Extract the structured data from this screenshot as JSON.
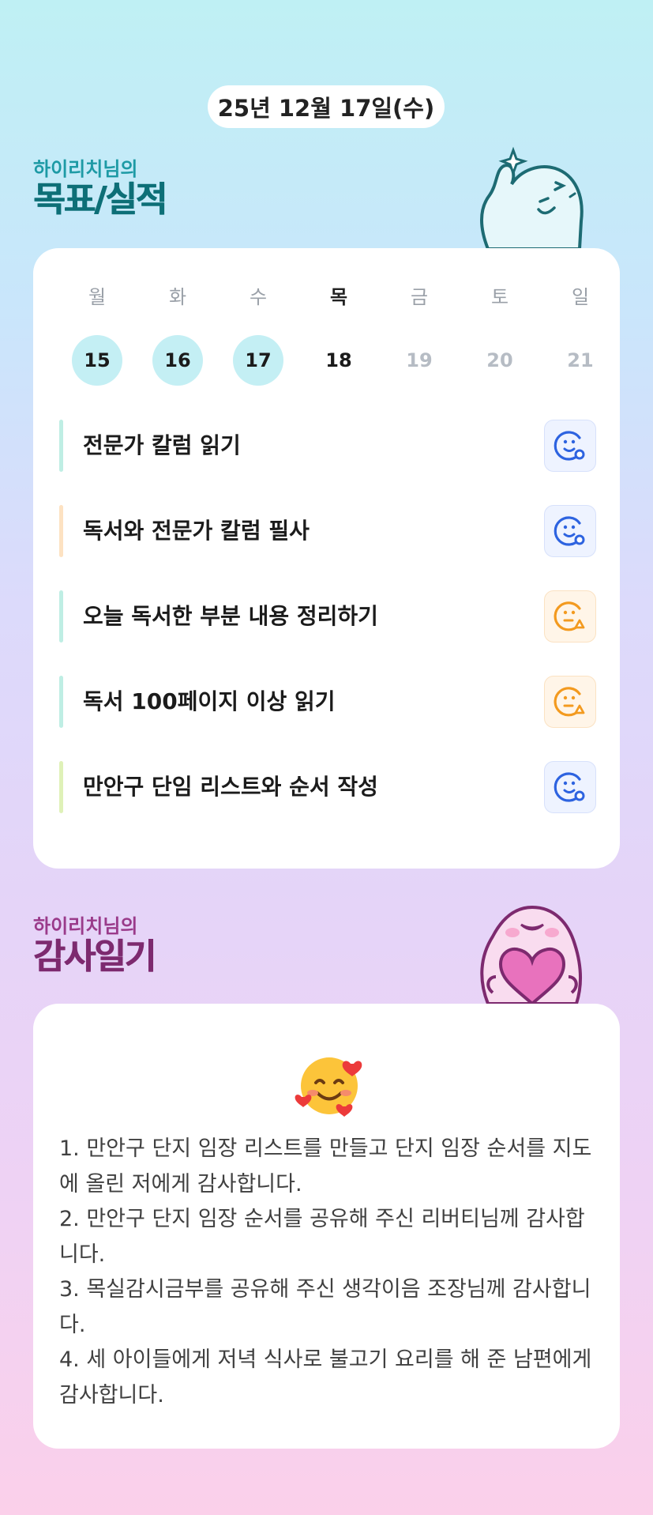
{
  "date_label": "25년 12월 17일(수)",
  "goals_section": {
    "subtitle": "하이리치님의",
    "title": "목표/실적"
  },
  "week": {
    "days": [
      "월",
      "화",
      "수",
      "목",
      "금",
      "토",
      "일"
    ],
    "dates": [
      "15",
      "16",
      "17",
      "18",
      "19",
      "20",
      "21"
    ]
  },
  "goals": [
    {
      "label": "전문가 칼럼 읽기",
      "bar_color": "#bfeee4",
      "status": "smile-check-icon",
      "color": "#2d63e0"
    },
    {
      "label": "독서와 전문가 칼럼 필사",
      "bar_color": "#fde2c2",
      "status": "smile-check-icon",
      "color": "#2d63e0"
    },
    {
      "label": "오늘 독서한 부분 내용 정리하기",
      "bar_color": "#bfeee4",
      "status": "neutral-triangle-icon",
      "color": "#f39a1f"
    },
    {
      "label": "독서 100페이지 이상 읽기",
      "bar_color": "#bfeee4",
      "status": "neutral-triangle-icon",
      "color": "#f39a1f"
    },
    {
      "label": "만안구 단임 리스트와 순서 작성",
      "bar_color": "#dff1b8",
      "status": "smile-check-icon",
      "color": "#2d63e0"
    }
  ],
  "diary_section": {
    "subtitle": "하이리치님의",
    "title": "감사일기"
  },
  "diary": {
    "emoji": "smiling-face-with-hearts-icon",
    "entries": [
      "1. 만안구 단지 임장 리스트를 만들고 단지 임장 순서를 지도에 올린 저에게 감사합니다.",
      "2. 만안구 단지 임장 순서를 공유해 주신 리버티님께 감사합니다.",
      "3. 목실감시금부를 공유해 주신 생각이음 조장님께 감사합니다.",
      "4. 세 아이들에게 저녁 식사로 불고기 요리를 해 준 남편에게 감사합니다."
    ]
  }
}
